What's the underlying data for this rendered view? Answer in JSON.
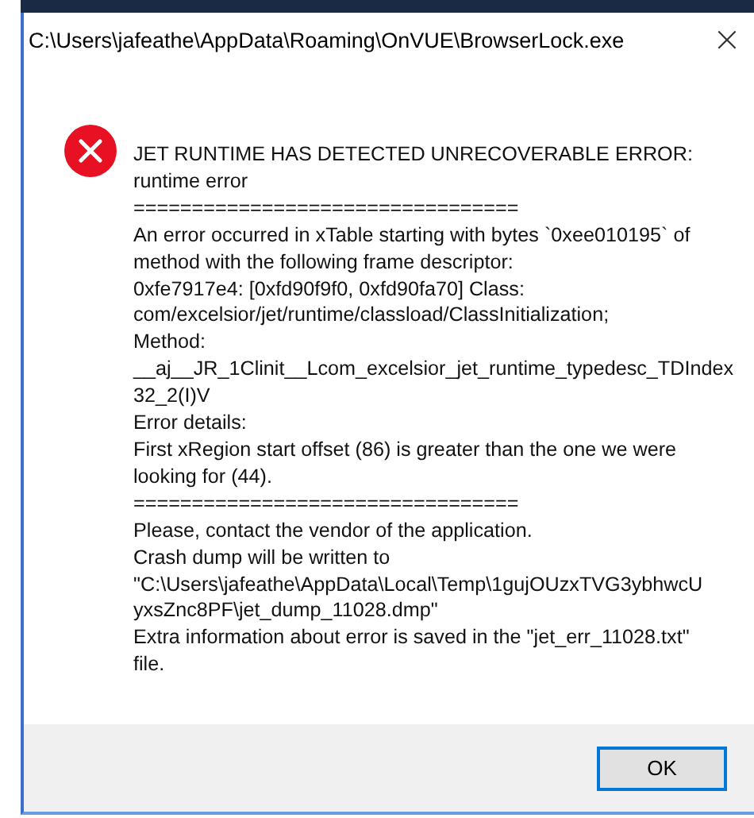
{
  "window": {
    "title": "C:\\Users\\jafeathe\\AppData\\Roaming\\OnVUE\\BrowserLock.exe",
    "close": "×"
  },
  "message_lines": [
    "JET RUNTIME HAS DETECTED UNRECOVERABLE ERROR:",
    "runtime error",
    "=================================",
    "An error occurred in xTable starting with bytes `0xee010195` of",
    "method with the following frame descriptor:",
    "0xfe7917e4: [0xfd90f9f0, 0xfd90fa70] Class:",
    "com/excelsior/jet/runtime/classload/ClassInitialization;",
    "Method:",
    "__aj__JR_1Clinit__Lcom_excelsior_jet_runtime_typedesc_TDIndex",
    "32_2(I)V",
    "Error details:",
    "First xRegion start offset (86) is greater than the one we were",
    "looking for (44).",
    "=================================",
    "Please, contact the vendor of the application.",
    "Crash dump will be written to",
    "\"C:\\Users\\jafeathe\\AppData\\Local\\Temp\\1gujOUzxTVG3ybhwcU",
    "yxsZnc8PF\\jet_dump_11028.dmp\"",
    "Extra information about error is saved in the \"jet_err_11028.txt\"",
    "file."
  ],
  "buttons": [
    {
      "label": "OK",
      "focused": true
    }
  ]
}
